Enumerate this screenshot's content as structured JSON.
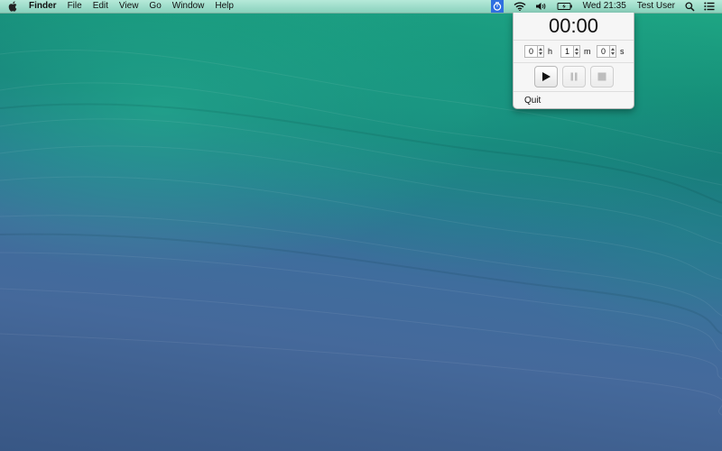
{
  "menubar": {
    "app_name": "Finder",
    "menus": [
      "File",
      "Edit",
      "View",
      "Go",
      "Window",
      "Help"
    ],
    "clock": "Wed 21:35",
    "user": "Test User",
    "status_icons": [
      "timer-icon",
      "wifi-icon",
      "volume-icon",
      "battery-icon",
      "spotlight-icon",
      "notification-center-icon"
    ]
  },
  "timer": {
    "display": "00:00",
    "hours": "0",
    "minutes": "1",
    "seconds": "0",
    "hours_unit": "h",
    "minutes_unit": "m",
    "seconds_unit": "s",
    "buttons": [
      "play",
      "pause",
      "stop"
    ],
    "quit_label": "Quit"
  }
}
